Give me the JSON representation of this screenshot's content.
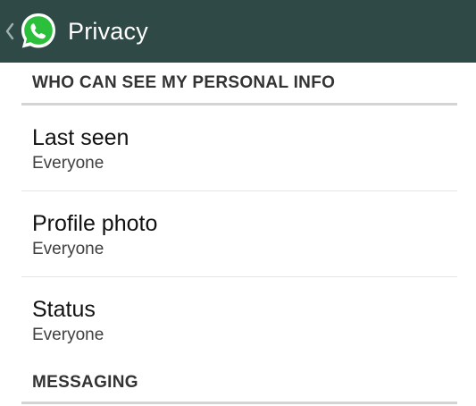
{
  "action_bar": {
    "title": "Privacy",
    "bar_color": "#2f4a46",
    "logo_icon": "whatsapp-logo-icon",
    "back_icon": "chevron-left-icon"
  },
  "sections": [
    {
      "header": "WHO CAN SEE MY PERSONAL INFO",
      "items": [
        {
          "title": "Last seen",
          "summary": "Everyone"
        },
        {
          "title": "Profile photo",
          "summary": "Everyone"
        },
        {
          "title": "Status",
          "summary": "Everyone"
        }
      ]
    },
    {
      "header": "MESSAGING"
    }
  ]
}
